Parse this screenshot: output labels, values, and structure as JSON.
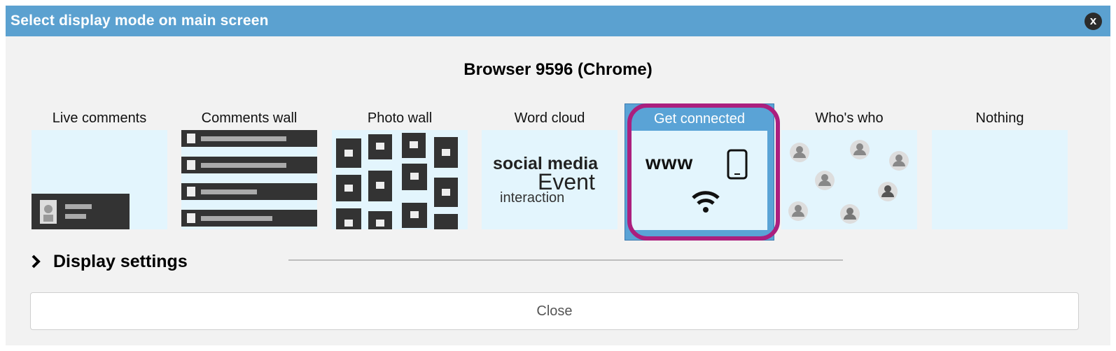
{
  "dialog": {
    "title": "Select display mode on main screen",
    "close_icon_glyph": "x",
    "browser_name": "Browser 9596 (Chrome)",
    "modes": [
      {
        "id": "live-comments",
        "label": "Live comments",
        "selected": false
      },
      {
        "id": "comments-wall",
        "label": "Comments wall",
        "selected": false
      },
      {
        "id": "photo-wall",
        "label": "Photo wall",
        "selected": false
      },
      {
        "id": "word-cloud",
        "label": "Word cloud",
        "selected": false
      },
      {
        "id": "get-connected",
        "label": "Get connected",
        "selected": true
      },
      {
        "id": "whos-who",
        "label": "Who's who",
        "selected": false
      },
      {
        "id": "nothing",
        "label": "Nothing",
        "selected": false
      }
    ],
    "word_cloud": {
      "word1": "social media",
      "word2": "Event",
      "word3": "interaction"
    },
    "get_connected": {
      "www_text": "www",
      "icons": [
        "phone-icon",
        "wifi-icon"
      ]
    },
    "display_settings_label": "Display settings",
    "close_button_label": "Close",
    "colors": {
      "titlebar": "#5ba1d0",
      "selected_mode": "#5aa3d6",
      "highlight": "#ab1f7e",
      "thumb_bg": "#e3f5fd"
    }
  }
}
